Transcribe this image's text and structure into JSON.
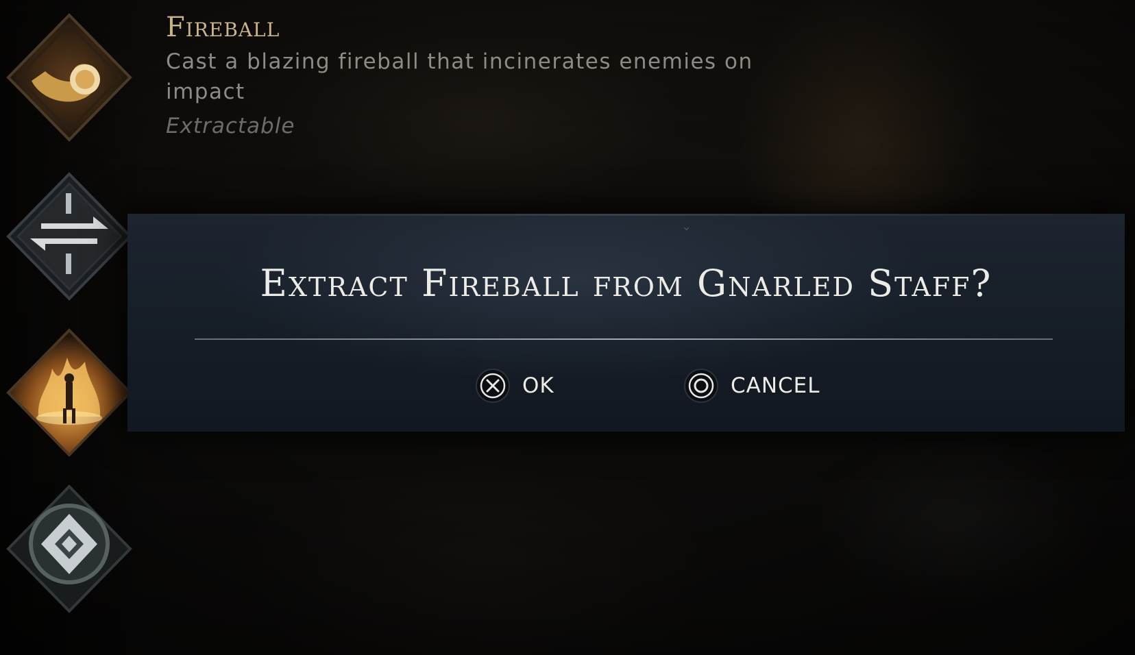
{
  "skill": {
    "name": "Fireball",
    "description": "Cast a blazing fireball that incinerates enemies on impact",
    "tag": "Extractable"
  },
  "slots": [
    {
      "name": "fireball-skill-slot",
      "icon": "fire-swirl-icon",
      "accent": "#c89a4a"
    },
    {
      "name": "swap-skill-slot",
      "icon": "swap-arrows-icon",
      "accent": "#b7bcc0"
    },
    {
      "name": "flame-aura-skill-slot",
      "icon": "flame-figure-icon",
      "accent": "#e0a040"
    },
    {
      "name": "ward-skill-slot",
      "icon": "diamond-rune-icon",
      "accent": "#c7cdd0"
    }
  ],
  "dialog": {
    "title": "Extract Fireball from Gnarled Staff?",
    "ok": {
      "label": "OK",
      "icon": "cross-button-icon"
    },
    "cancel": {
      "label": "CANCEL",
      "icon": "circle-button-icon"
    }
  },
  "colors": {
    "title_text": "#ecebe6",
    "skill_name": "#c9b48a",
    "dialog_bg": "#18202a"
  }
}
